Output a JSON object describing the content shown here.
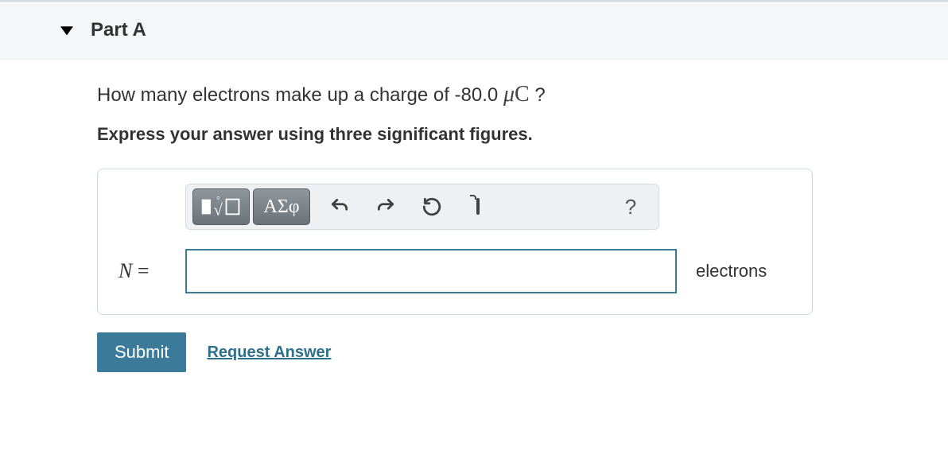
{
  "part": {
    "label": "Part A"
  },
  "question": {
    "prefix": "How many electrons make up a charge of -80.0 ",
    "unit_mu": "μ",
    "unit_C": "C",
    "suffix": " ?"
  },
  "instruction": "Express your answer using three significant figures.",
  "toolbar": {
    "templates_label": "templates",
    "greek_label": "ΑΣφ",
    "undo": "undo",
    "redo": "redo",
    "reset": "reset",
    "keyboard": "keyboard",
    "help": "?"
  },
  "answer": {
    "variable": "N",
    "equals": " =",
    "value": "",
    "units": "electrons"
  },
  "actions": {
    "submit": "Submit",
    "request": "Request Answer"
  }
}
